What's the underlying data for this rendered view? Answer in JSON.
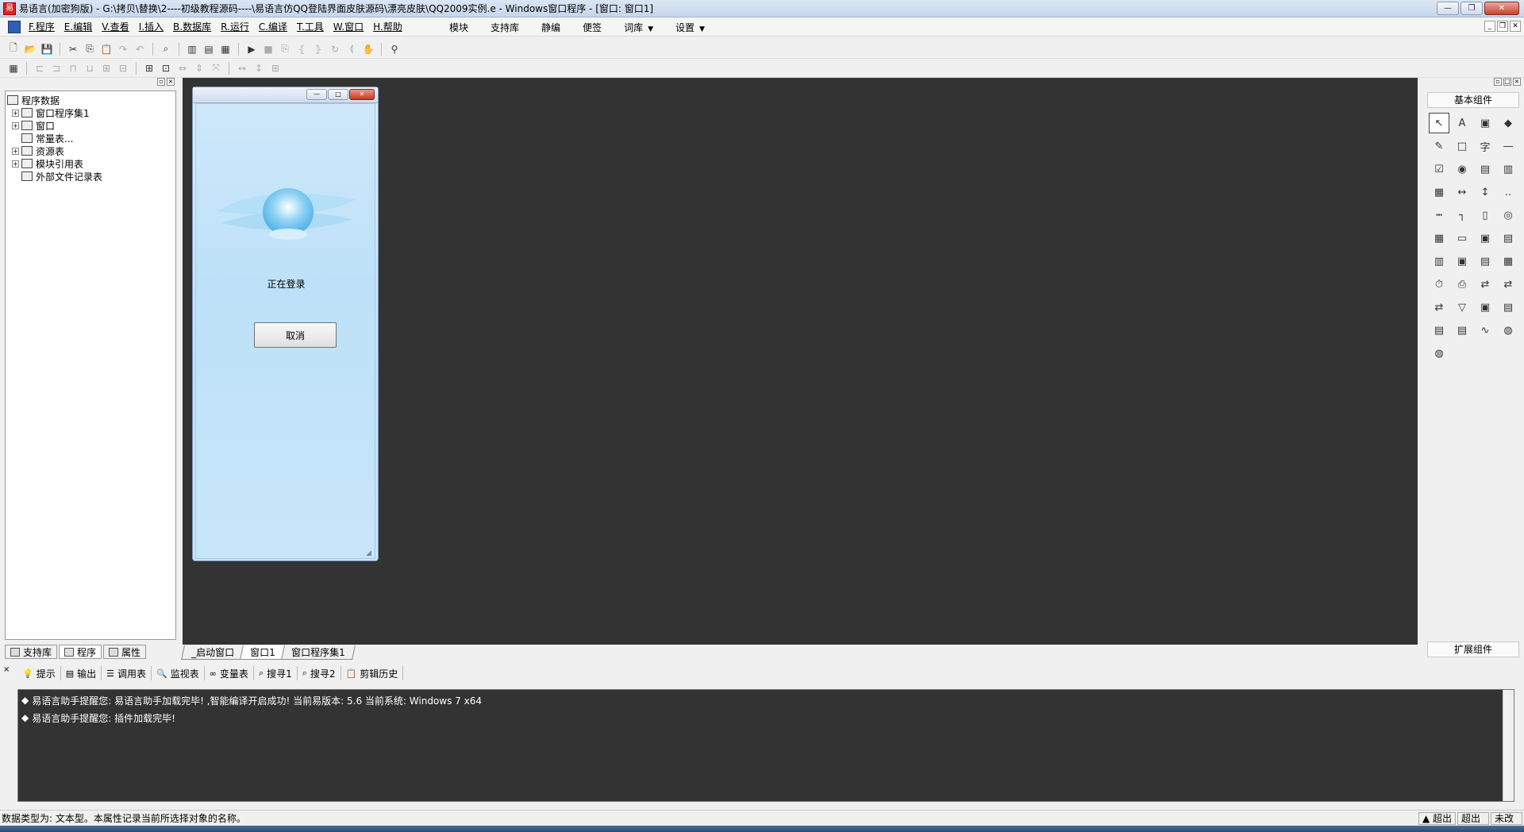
{
  "titlebar": {
    "title": "易语言(加密狗版) - G:\\拷贝\\替换\\2----初级教程源码----\\易语言仿QQ登陆界面皮肤源码\\漂亮皮肤\\QQ2009实例.e - Windows窗口程序 - [窗口: 窗口1]",
    "minimize": "—",
    "restore": "❐",
    "close": "✕"
  },
  "menubar": {
    "items": [
      "F.程序",
      "E.编辑",
      "V.查看",
      "I.插入",
      "B.数据库",
      "R.运行",
      "C.编译",
      "T.工具",
      "W.窗口",
      "H.帮助"
    ],
    "extra": [
      "模块",
      "支持库",
      "静编",
      "便签",
      "词库",
      "设置"
    ]
  },
  "left_panel": {
    "tree": [
      {
        "label": "程序数据",
        "expander": "",
        "icon": "program-data-icon"
      },
      {
        "label": "窗口程序集1",
        "expander": "+",
        "icon": "module-icon"
      },
      {
        "label": "窗口",
        "expander": "+",
        "icon": "window-icon"
      },
      {
        "label": "常量表...",
        "expander": "",
        "icon": "constant-icon"
      },
      {
        "label": "资源表",
        "expander": "+",
        "icon": "resource-icon"
      },
      {
        "label": "模块引用表",
        "expander": "+",
        "icon": "module-ref-icon"
      },
      {
        "label": "外部文件记录表",
        "expander": "",
        "icon": "file-record-icon"
      }
    ],
    "tabs": [
      "支持库",
      "程序",
      "属性"
    ]
  },
  "form_window": {
    "status_text": "正在登录",
    "cancel_label": "取消"
  },
  "right_panel": {
    "basic_title": "基本组件",
    "ext_title": "扩展组件",
    "components": [
      "↖",
      "A",
      "▣",
      "◆",
      "✎",
      "□",
      "字",
      "—",
      "☑",
      "◉",
      "▤",
      "▥",
      "▦",
      "↔",
      "↕",
      "‥",
      "┅",
      "┐",
      "▯",
      "◎",
      "▦",
      "▭",
      "▣",
      "▤",
      "▥",
      "▣",
      "▤",
      "▦",
      "⏱",
      "⎙",
      "⇄",
      "⇄",
      "⇄",
      "▽",
      "▣",
      "▤",
      "▤",
      "▤",
      "∿",
      "◍",
      "◍"
    ]
  },
  "doc_tabs": [
    "_启动窗口",
    "窗口1",
    "窗口程序集1"
  ],
  "output": {
    "tabs": [
      "提示",
      "输出",
      "调用表",
      "监视表",
      "变量表",
      "搜寻1",
      "搜寻2",
      "剪辑历史"
    ],
    "lines": [
      "易语言助手提醒您: 易语言助手加载完毕! ,智能编译开启成功! 当前易版本: 5.6 当前系统: Windows 7 x64",
      "易语言助手提醒您: 插件加载完毕!"
    ]
  },
  "statusbar": {
    "text": "数据类型为: 文本型。本属性记录当前所选择对象的名称。",
    "cells": [
      "超出",
      "超出",
      "未改"
    ]
  }
}
